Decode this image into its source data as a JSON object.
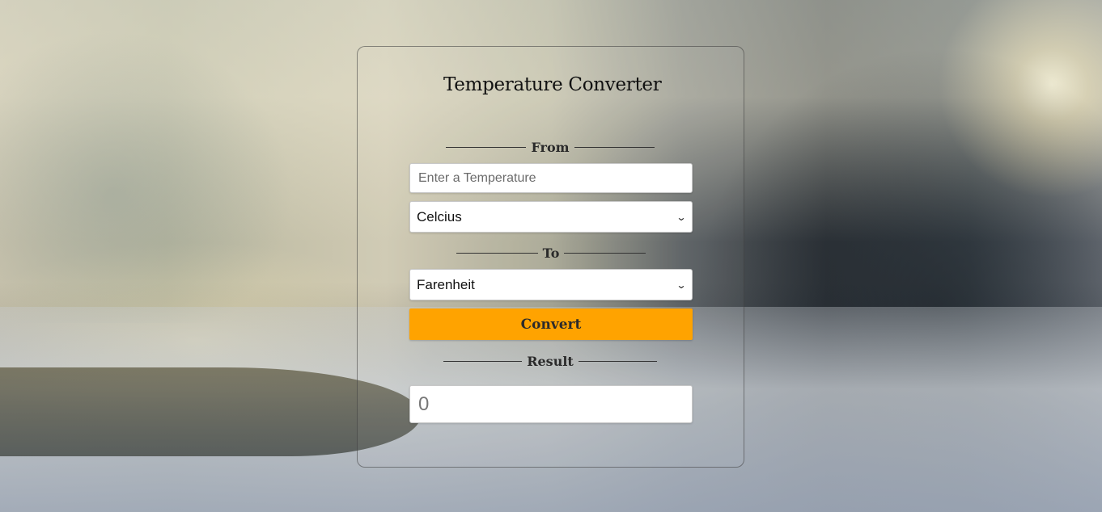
{
  "app": {
    "title": "Temperature Converter"
  },
  "from": {
    "section_label": "From",
    "temperature_placeholder": "Enter a Temperature",
    "unit_selected": "Celcius"
  },
  "to": {
    "section_label": "To",
    "unit_selected": "Farenheit"
  },
  "convert_label": "Convert",
  "result": {
    "section_label": "Result",
    "value": "0"
  },
  "colors": {
    "accent": "#ffa300"
  },
  "icons": {
    "dropdown": "chevron-down-icon"
  }
}
